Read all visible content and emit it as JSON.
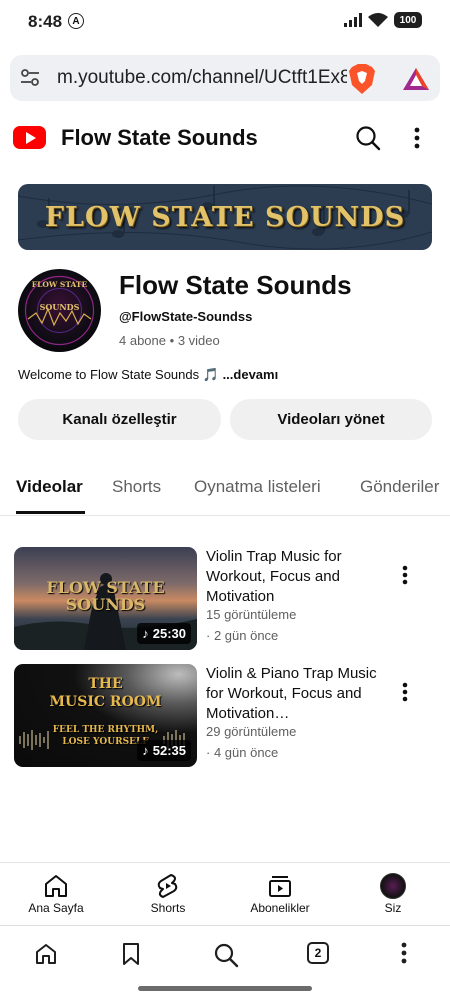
{
  "status": {
    "time": "8:48",
    "battery": "100"
  },
  "browser": {
    "url": "m.youtube.com/channel/UCtft1Ex8",
    "tab_count": "2"
  },
  "header": {
    "title": "Flow State Sounds"
  },
  "banner": {
    "text": "FLOW STATE SOUNDS"
  },
  "channel": {
    "name": "Flow State Sounds",
    "handle": "@FlowState-Soundss",
    "subscribers": "4 abone",
    "separator": "•",
    "video_count": "3 video",
    "description": "Welcome to Flow State Sounds 🎵",
    "more": "...devamı",
    "avatar_text_top": "FLOW STATE",
    "avatar_text_mid": "SOUNDS"
  },
  "buttons": {
    "customize": "Kanalı özelleştir",
    "manage": "Videoları yönet"
  },
  "tabs": [
    {
      "label": "Videolar"
    },
    {
      "label": "Shorts"
    },
    {
      "label": "Oynatma listeleri"
    },
    {
      "label": "Gönderiler"
    }
  ],
  "videos": [
    {
      "title": "Violin Trap Music for Workout, Focus and Motivation",
      "views": "15 görüntüleme",
      "age": "· 2 gün önce",
      "duration": "25:30",
      "thumb_line1": "FLOW STATE",
      "thumb_line2": "SOUNDS"
    },
    {
      "title": "Violin & Piano Trap Music for Workout, Focus and Motivation…",
      "views": "29 görüntüleme",
      "age": "· 4 gün önce",
      "duration": "52:35",
      "thumb_line1": "THE",
      "thumb_line2": "MUSIC ROOM",
      "thumb_line3": "FEEL THE RHYTHM,",
      "thumb_line4": "LOSE YOURSELF"
    }
  ],
  "bottom_nav": [
    {
      "label": "Ana Sayfa",
      "icon": "home-icon"
    },
    {
      "label": "Shorts",
      "icon": "shorts-icon"
    },
    {
      "label": "Abonelikler",
      "icon": "subscriptions-icon"
    },
    {
      "label": "Siz",
      "icon": "profile-avatar"
    }
  ],
  "colors": {
    "youtube_red": "#ff0000",
    "banner_bg": "#2c3d52",
    "banner_text": "#e2c36a"
  }
}
